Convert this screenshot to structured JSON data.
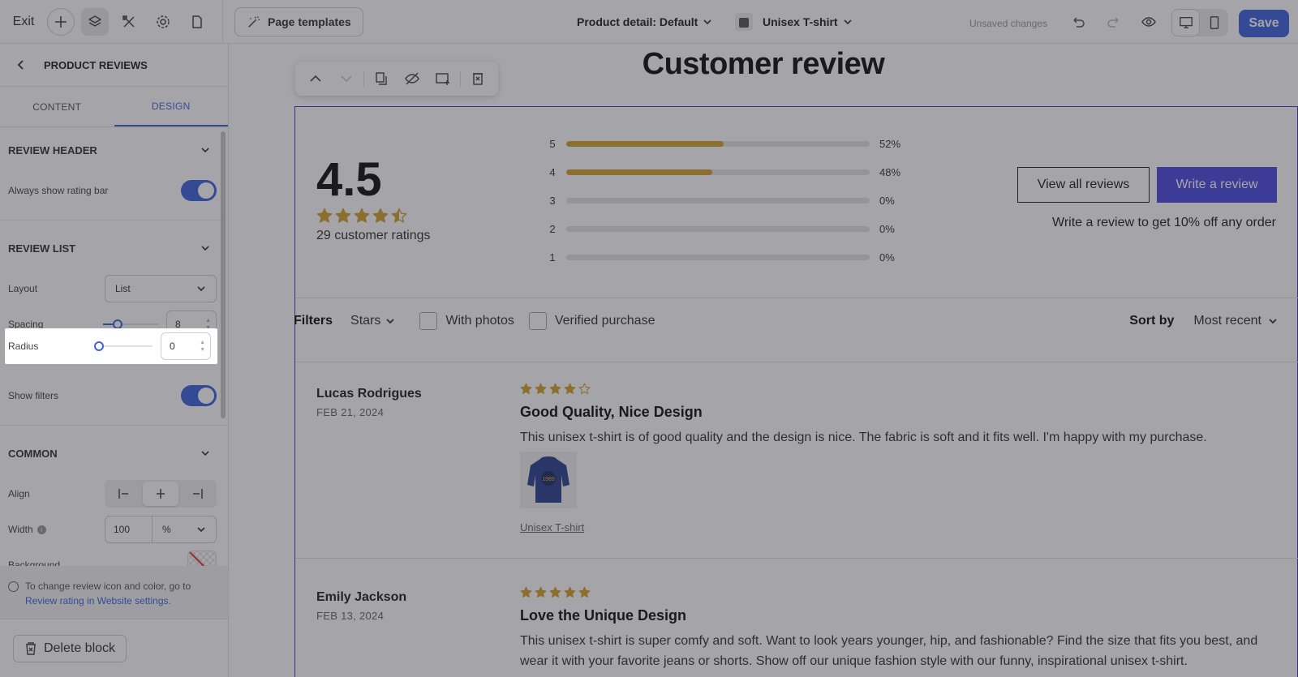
{
  "topbar": {
    "exit_label": "Exit",
    "page_templates_label": "Page templates",
    "product_detail_label": "Product detail: Default",
    "product_label": "Unisex T-shirt",
    "unsaved_label": "Unsaved changes",
    "save_label": "Save"
  },
  "sidebar": {
    "header_title": "PRODUCT REVIEWS",
    "tabs": [
      {
        "label": "CONTENT"
      },
      {
        "label": "DESIGN"
      }
    ],
    "review_header": {
      "title": "REVIEW HEADER",
      "always_show_label": "Always show rating bar"
    },
    "review_list": {
      "title": "REVIEW LIST",
      "layout_label": "Layout",
      "layout_value": "List",
      "spacing_label": "Spacing",
      "spacing_value": "8",
      "radius_label": "Radius",
      "radius_value": "0",
      "show_filters_label": "Show filters"
    },
    "common": {
      "title": "COMMON",
      "align_label": "Align",
      "width_label": "Width",
      "width_value": "100",
      "width_unit": "%",
      "background_label": "Background"
    },
    "note_text": "To change review icon and color, go to",
    "note_link": "Review rating in Website settings.",
    "delete_label": "Delete block"
  },
  "canvas": {
    "block_title": "Customer review",
    "summary": {
      "rating": "4.5",
      "star_rating": 4.5,
      "count_label": "29 customer ratings",
      "bars": [
        {
          "label": "5",
          "percent": 52,
          "text": "52%"
        },
        {
          "label": "4",
          "percent": 48,
          "text": "48%"
        },
        {
          "label": "3",
          "percent": 0,
          "text": "0%"
        },
        {
          "label": "2",
          "percent": 0,
          "text": "0%"
        },
        {
          "label": "1",
          "percent": 0,
          "text": "0%"
        }
      ],
      "view_all_label": "View all reviews",
      "write_label": "Write a review",
      "promo_label": "Write a review to get 10% off any order"
    },
    "filters": {
      "title": "Filters",
      "stars_label": "Stars",
      "with_photos_label": "With photos",
      "verified_label": "Verified purchase",
      "sort_by_label": "Sort by",
      "sort_value": "Most recent"
    },
    "reviews": [
      {
        "name": "Lucas Rodrigues",
        "date": "FEB 21, 2024",
        "stars": 4,
        "title": "Good Quality, Nice Design",
        "body": "This unisex t-shirt is of good quality and the design is nice. The fabric is soft and it fits well. I'm happy with my purchase.",
        "image_text": "1989",
        "product_link": "Unisex T-shirt"
      },
      {
        "name": "Emily Jackson",
        "date": "FEB 13, 2024",
        "stars": 5,
        "title": "Love the Unique Design",
        "body": "This unisex t-shirt is super comfy and soft. Want to look years younger, hip, and fashionable? Find the size that fits you best, and wear it with your favorite jeans or shorts. Show off our unique fashion style with our funny, inspirational unisex t-shirt."
      }
    ]
  },
  "colors": {
    "accent": "#3e63dd",
    "star": "#d4a32b",
    "write_btn": "#4b4be0",
    "block_border": "#4b2fcf"
  }
}
